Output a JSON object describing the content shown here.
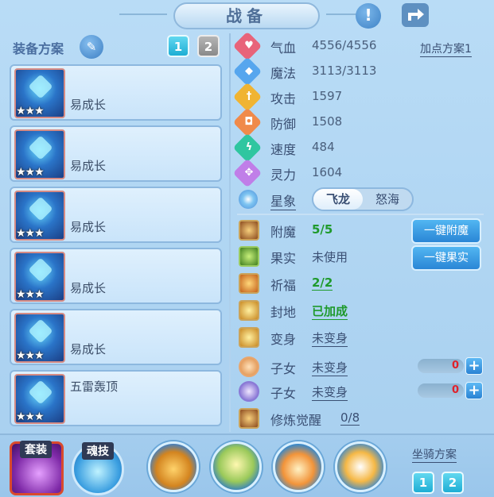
{
  "header": {
    "title": "战备"
  },
  "equip_plan": {
    "label": "装备方案",
    "slots": [
      "1",
      "2"
    ]
  },
  "equipment": [
    {
      "name": "易成长",
      "stars": "★★★"
    },
    {
      "name": "易成长",
      "stars": "★★★"
    },
    {
      "name": "易成长",
      "stars": "★★★"
    },
    {
      "name": "易成长",
      "stars": "★★★"
    },
    {
      "name": "易成长",
      "stars": "★★★"
    },
    {
      "name": "五雷轰顶",
      "stars": "★★★"
    }
  ],
  "attributes": [
    {
      "label": "气血",
      "value": "4556/4556",
      "icon": "heart-icon",
      "color": "#e8647a"
    },
    {
      "label": "魔法",
      "value": "3113/3113",
      "icon": "mana-icon",
      "color": "#56a6ee"
    },
    {
      "label": "攻击",
      "value": "1597",
      "icon": "sword-icon",
      "color": "#f0b432"
    },
    {
      "label": "防御",
      "value": "1508",
      "icon": "shield-icon",
      "color": "#f08a4a"
    },
    {
      "label": "速度",
      "value": "484",
      "icon": "lightning-icon",
      "color": "#2fc6a0"
    },
    {
      "label": "灵力",
      "value": "1604",
      "icon": "spirit-icon",
      "color": "#c07ee8"
    }
  ],
  "add_point_plan": "加点方案1",
  "star_sign": {
    "label": "星象",
    "options": [
      "飞龙",
      "怒海"
    ],
    "selected": "飞龙"
  },
  "features": [
    {
      "label": "附魔",
      "value": "5/5"
    },
    {
      "label": "果实",
      "value": "未使用"
    },
    {
      "label": "祈福",
      "value": "2/2"
    },
    {
      "label": "封地",
      "value": "已加成"
    },
    {
      "label": "变身",
      "value": "未变身"
    },
    {
      "label": "子女",
      "value": "未变身"
    },
    {
      "label": "子女",
      "value": "未变身"
    },
    {
      "label": "修炼觉醒",
      "value": "0/8"
    }
  ],
  "buttons": {
    "enchant_all": "一键附魔",
    "fruit_all": "一键果实"
  },
  "counters": [
    "0",
    "0"
  ],
  "bottom": {
    "suit_label": "套装",
    "soul_label": "魂技",
    "mount_label": "坐骑方案",
    "mount_slots": [
      "1",
      "2"
    ]
  }
}
